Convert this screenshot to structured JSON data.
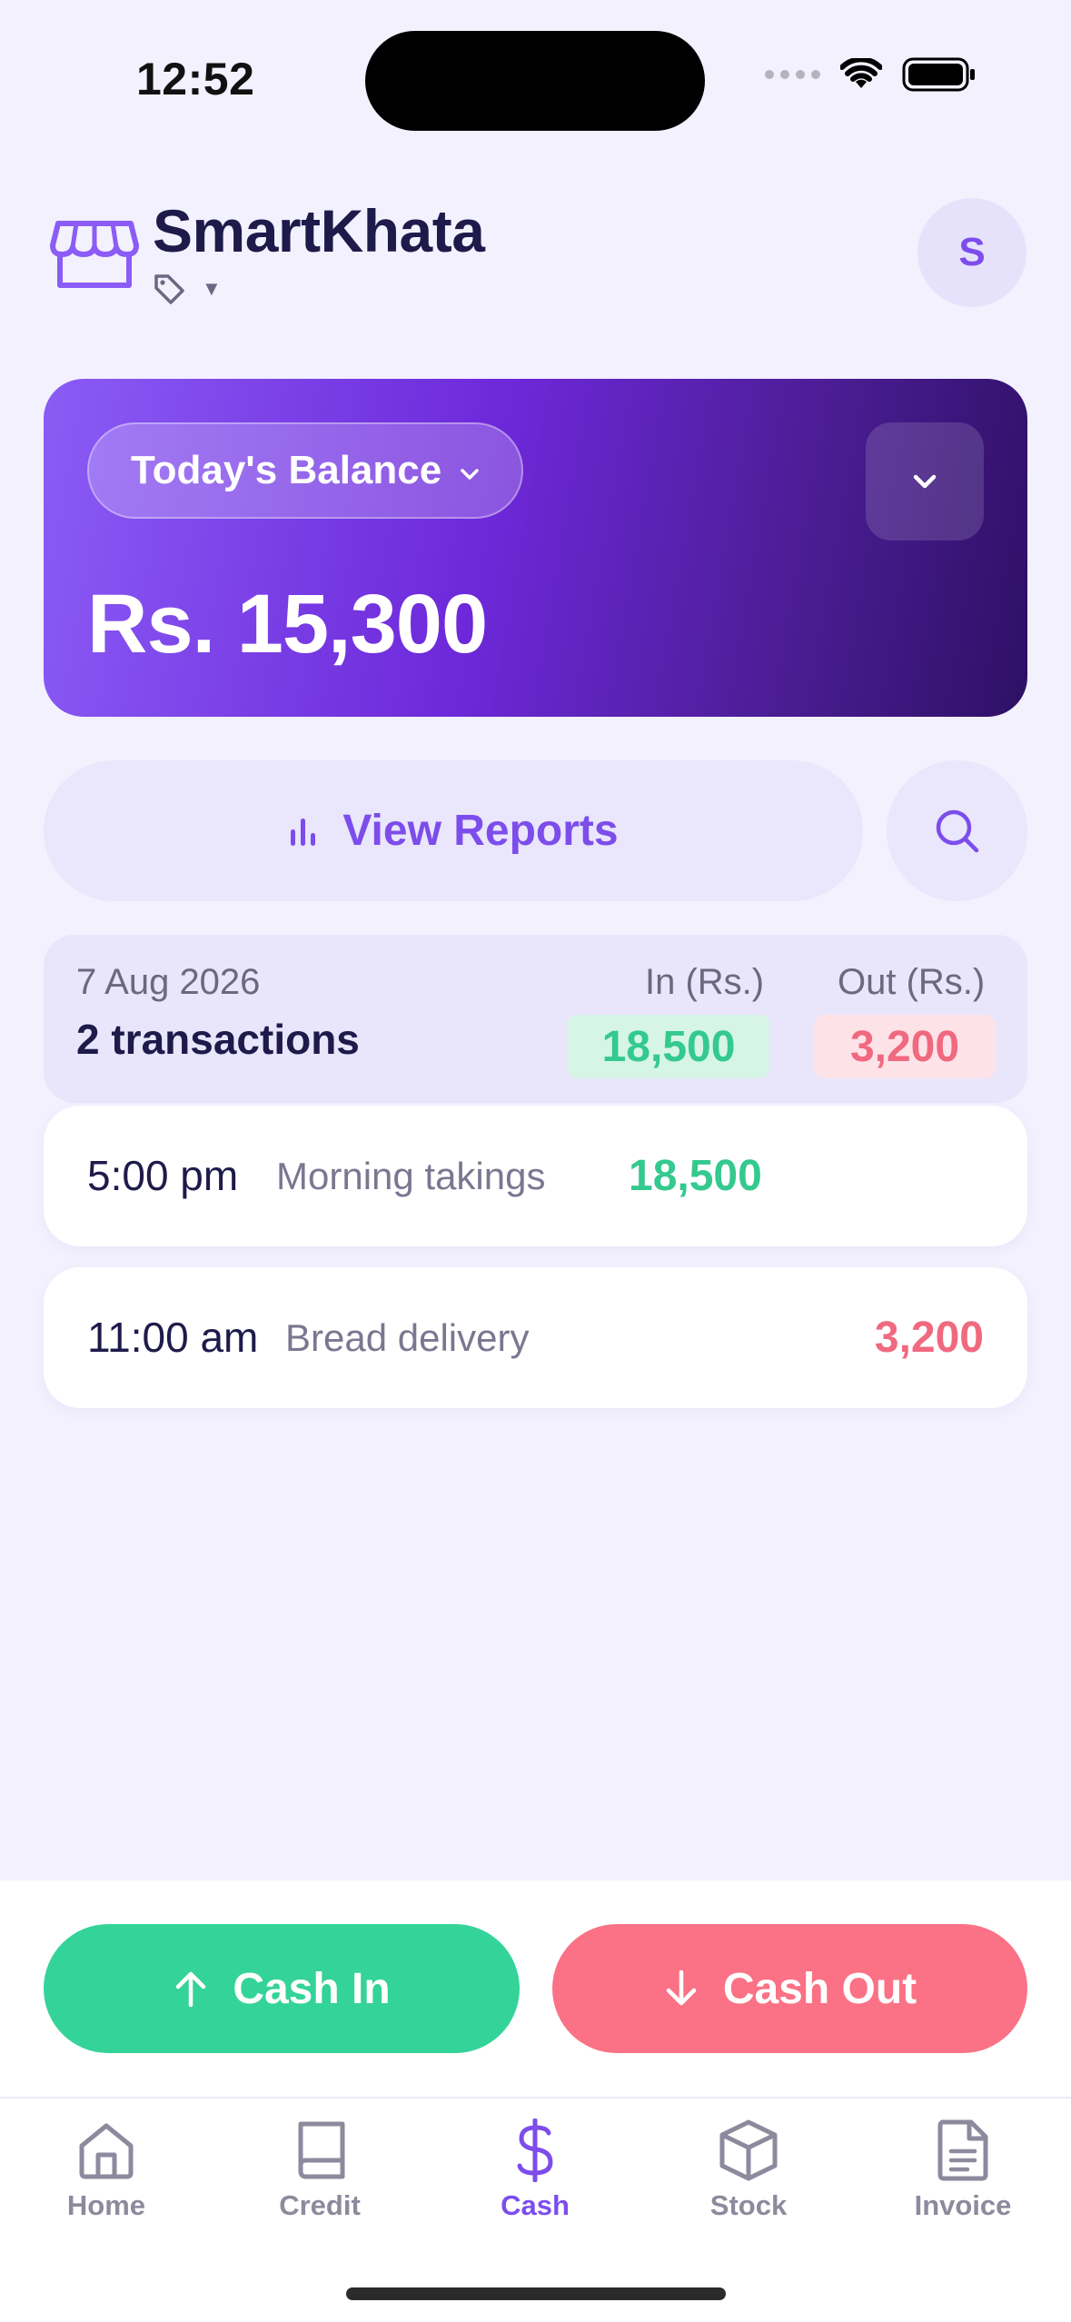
{
  "status_bar": {
    "time": "12:52"
  },
  "header": {
    "title": "SmartKhata",
    "avatar_initial": "S"
  },
  "balance": {
    "period_label": "Today's Balance",
    "amount": "Rs. 15,300"
  },
  "actions": {
    "reports_label": "View Reports"
  },
  "summary": {
    "date": "7 Aug 2026",
    "count": "2 transactions",
    "in_header": "In (Rs.)",
    "out_header": "Out (Rs.)",
    "in_total": "18,500",
    "out_total": "3,200"
  },
  "transactions": [
    {
      "time": "5:00 pm",
      "description": "Morning takings",
      "in": "18,500",
      "out": ""
    },
    {
      "time": "11:00 am",
      "description": "Bread delivery",
      "in": "",
      "out": "3,200"
    }
  ],
  "bottom_actions": {
    "cash_in": "Cash In",
    "cash_out": "Cash Out"
  },
  "tabs": [
    {
      "label": "Home",
      "icon": "home-icon"
    },
    {
      "label": "Credit",
      "icon": "book-icon"
    },
    {
      "label": "Cash",
      "icon": "dollar-icon",
      "active": true
    },
    {
      "label": "Stock",
      "icon": "box-icon"
    },
    {
      "label": "Invoice",
      "icon": "document-icon"
    }
  ],
  "colors": {
    "accent": "#7C4DEB",
    "cash_in": "#34D399",
    "cash_out": "#FB7185",
    "background": "#F3F1FE"
  }
}
